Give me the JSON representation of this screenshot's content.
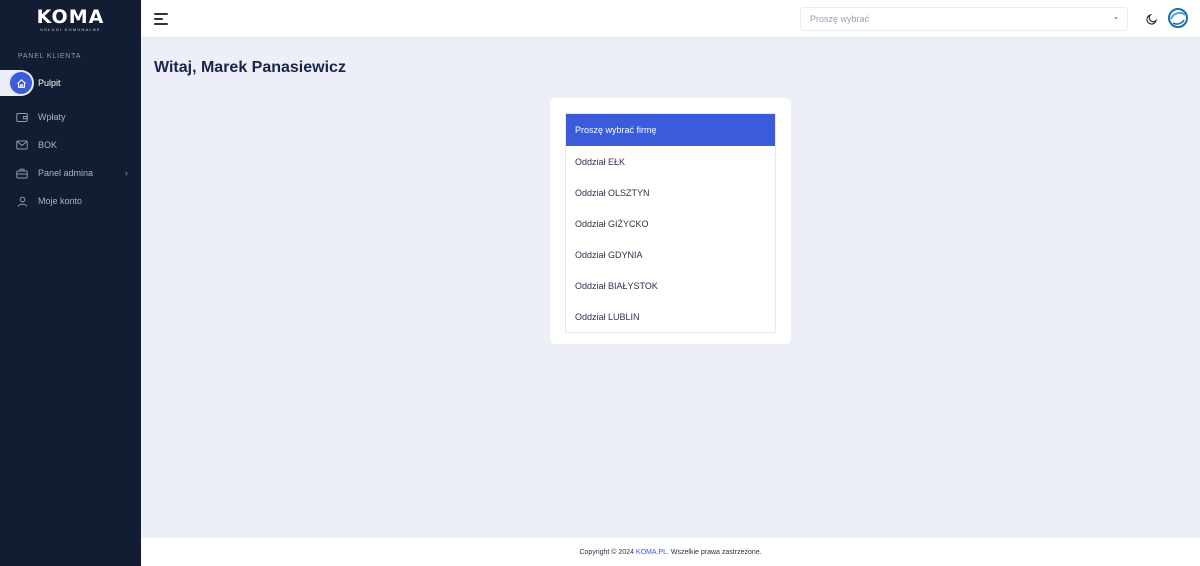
{
  "brand": {
    "logo_text": "KOMA",
    "logo_subtitle": "USŁUGI KOMUNALNE",
    "accent_color": "#3b5bdb",
    "sidebar_color": "#121d33"
  },
  "sidebar": {
    "section_label": "PANEL KLIENTA",
    "items": [
      {
        "label": "Pulpit",
        "icon": "home-icon",
        "active": true
      },
      {
        "label": "Wpłaty",
        "icon": "wallet-icon"
      },
      {
        "label": "BOK",
        "icon": "mail-icon"
      },
      {
        "label": "Panel admina",
        "icon": "briefcase-icon",
        "has_submenu": true
      },
      {
        "label": "Moje konto",
        "icon": "user-icon"
      }
    ]
  },
  "topbar": {
    "menu_icon": "hamburger-menu-icon",
    "select_placeholder": "Proszę wybrać",
    "theme_icon": "moon-icon",
    "avatar_icon": "user-avatar-icon"
  },
  "main": {
    "greeting": "Witaj, Marek Panasiewicz",
    "company_list": {
      "header": "Proszę wybrać firmę",
      "options": [
        "Oddział EŁK",
        "Oddział OLSZTYN",
        "Oddział GIŻYCKO",
        "Oddział GDYNIA",
        "Oddział BIAŁYSTOK",
        "Oddział LUBLIN"
      ]
    }
  },
  "footer": {
    "prefix": "Copyright © 2024",
    "link": "KOMA.PL",
    "suffix": ". Wszelkie prawa zastrzeżone."
  }
}
